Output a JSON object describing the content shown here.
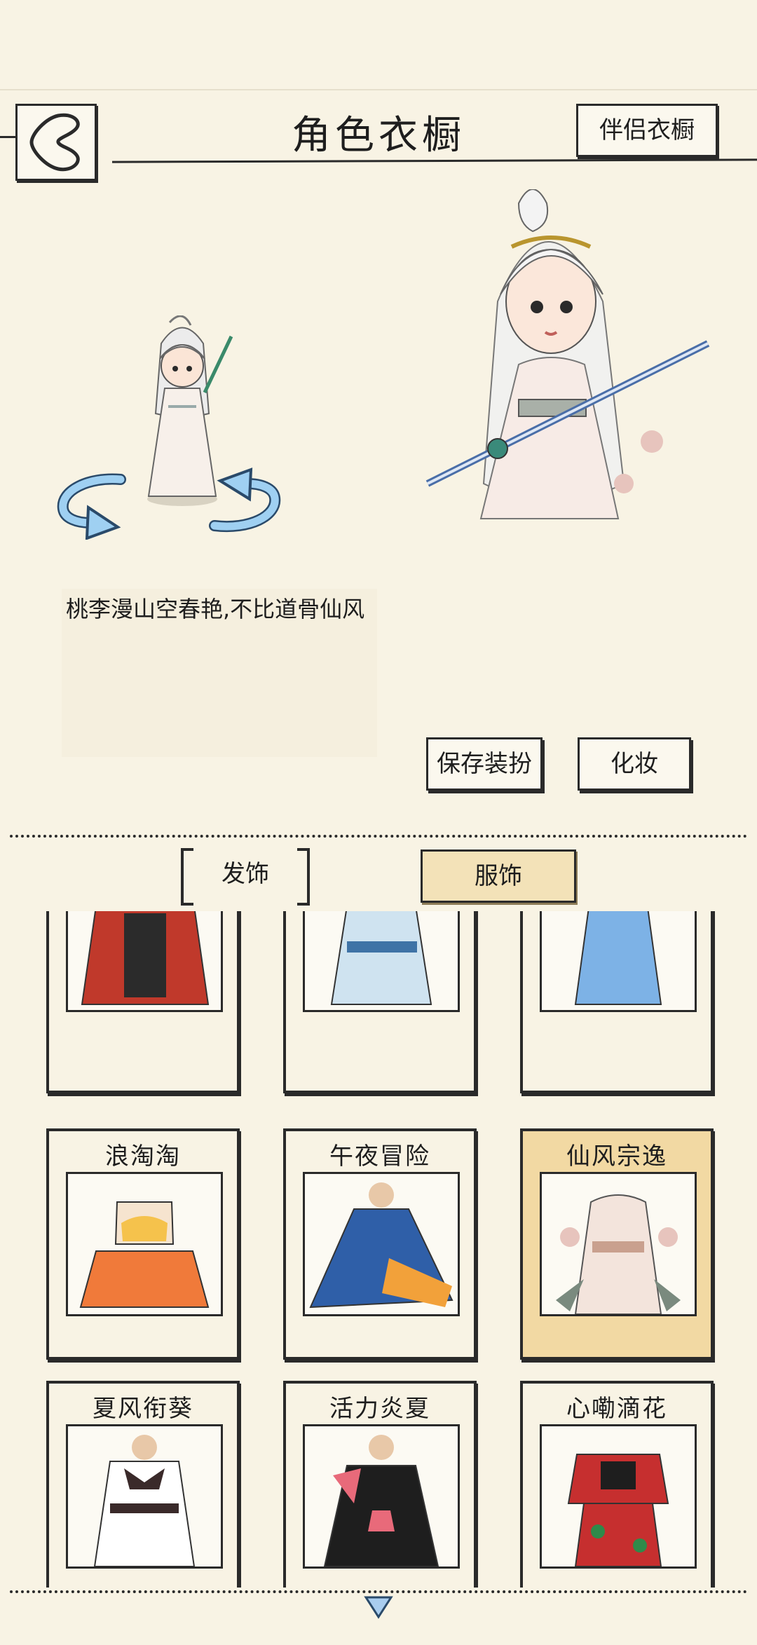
{
  "header": {
    "title": "角色衣橱",
    "companion_wardrobe": "伴侣衣橱"
  },
  "description": "桃李漫山空春艳,不比道骨仙风",
  "actions": {
    "save": "保存装扮",
    "makeup": "化妆"
  },
  "tabs": {
    "hair": "发饰",
    "clothing": "服饰",
    "active": "clothing"
  },
  "outfits": [
    {
      "name": "",
      "palette": [
        "#c0392b",
        "#2b2b2b",
        "#e8c8a8"
      ],
      "selected": false
    },
    {
      "name": "",
      "palette": [
        "#cfe3f0",
        "#3f73a6",
        "#f4f6f8"
      ],
      "selected": false
    },
    {
      "name": "",
      "palette": [
        "#7db2e6",
        "#f2a76a",
        "#f4efe4"
      ],
      "selected": false
    },
    {
      "name": "浪淘淘",
      "palette": [
        "#f07a3a",
        "#f5c24c",
        "#f6e4cf"
      ],
      "selected": false
    },
    {
      "name": "午夜冒险",
      "palette": [
        "#2f5fa8",
        "#f2a13a",
        "#e8c8a8"
      ],
      "selected": false
    },
    {
      "name": "仙风宗逸",
      "palette": [
        "#f3e4dc",
        "#c9a08e",
        "#7a8a7e"
      ],
      "selected": true
    },
    {
      "name": "夏风衔葵",
      "palette": [
        "#ffffff",
        "#3a2a2a",
        "#e8c8a8"
      ],
      "selected": false
    },
    {
      "name": "活力炎夏",
      "palette": [
        "#1e1e1e",
        "#e86a7a",
        "#e8c8a8"
      ],
      "selected": false
    },
    {
      "name": "心嘞滴花",
      "palette": [
        "#c62f2f",
        "#1e1e1e",
        "#2f8a4a"
      ],
      "selected": false
    }
  ],
  "colors": {
    "background": "#f8f3e4",
    "selected_card": "#f2d9a3",
    "ink": "#2a2a2a",
    "rotate_arrow": "#6fb0e6"
  },
  "icons": {
    "back": "back-chevron-icon",
    "rotate": "rotate-arrow-icon",
    "scroll": "scroll-down-triangle-icon"
  }
}
